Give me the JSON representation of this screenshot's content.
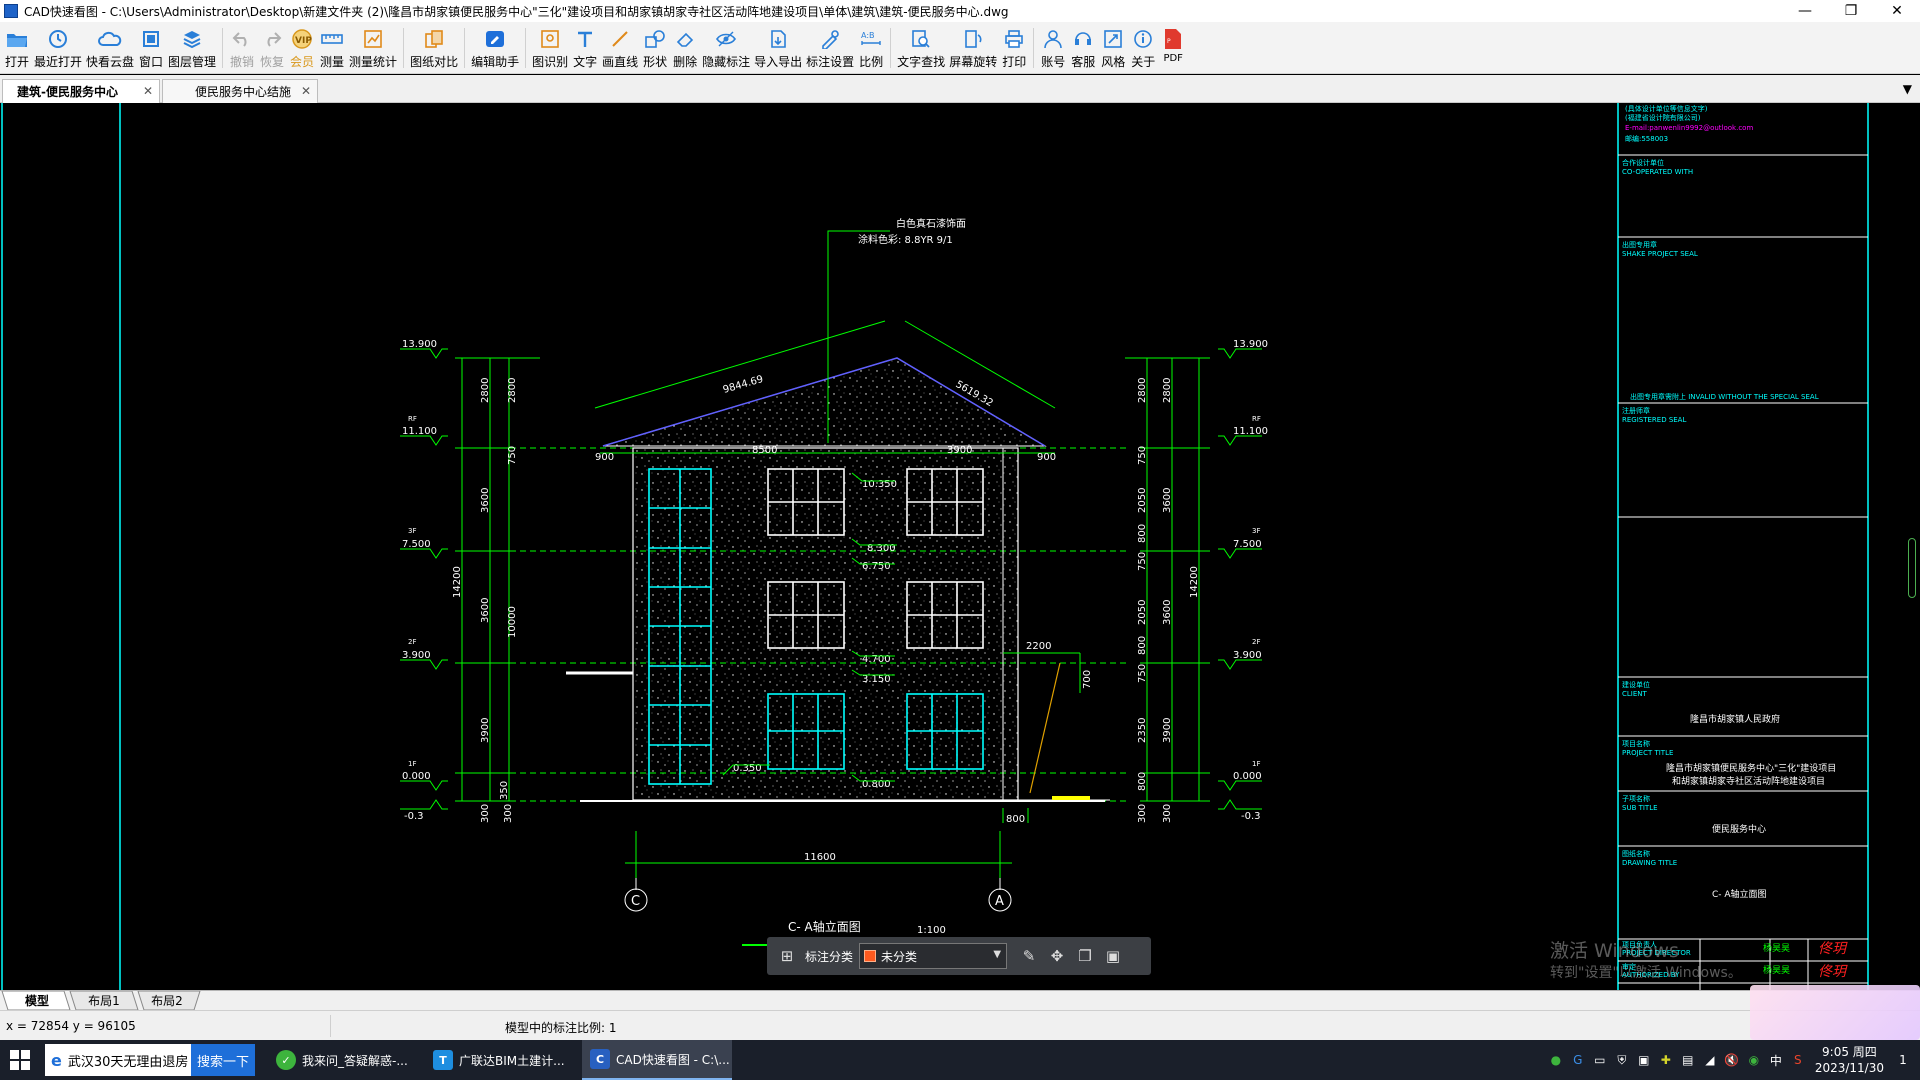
{
  "window": {
    "title": "CAD快速看图 - C:\\Users\\Administrator\\Desktop\\新建文件夹 (2)\\隆昌市胡家镇便民服务中心\"三化\"建设项目和胡家镇胡家寺社区活动阵地建设项目\\单体\\建筑\\建筑-便民服务中心.dwg",
    "controls": {
      "minimize": "—",
      "maximize": "❐",
      "close": "✕"
    }
  },
  "toolbar": [
    {
      "label": "打开",
      "icon": "open-folder-icon"
    },
    {
      "label": "最近打开",
      "icon": "recent-icon"
    },
    {
      "label": "快看云盘",
      "icon": "cloud-icon"
    },
    {
      "label": "窗口",
      "icon": "window-icon"
    },
    {
      "label": "图层管理",
      "icon": "layers-icon"
    },
    {
      "label": "撤销",
      "icon": "undo-icon",
      "disabled": true
    },
    {
      "label": "恢复",
      "icon": "redo-icon",
      "disabled": true
    },
    {
      "label": "会员",
      "icon": "vip-icon",
      "vip": true
    },
    {
      "label": "测量",
      "icon": "measure-icon"
    },
    {
      "label": "测量统计",
      "icon": "measure-stats-icon"
    },
    {
      "label": "图纸对比",
      "icon": "compare-icon"
    },
    {
      "label": "编辑助手",
      "icon": "edit-assistant-icon"
    },
    {
      "label": "图识别",
      "icon": "recognize-icon"
    },
    {
      "label": "文字",
      "icon": "text-icon"
    },
    {
      "label": "画直线",
      "icon": "line-icon"
    },
    {
      "label": "形状",
      "icon": "shape-icon"
    },
    {
      "label": "删除",
      "icon": "eraser-icon"
    },
    {
      "label": "隐藏标注",
      "icon": "hide-annotation-icon"
    },
    {
      "label": "导入导出",
      "icon": "import-export-icon"
    },
    {
      "label": "标注设置",
      "icon": "annotation-settings-icon"
    },
    {
      "label": "比例",
      "icon": "scale-icon"
    },
    {
      "label": "文字查找",
      "icon": "text-search-icon"
    },
    {
      "label": "屏幕旋转",
      "icon": "rotate-screen-icon"
    },
    {
      "label": "打印",
      "icon": "print-icon"
    },
    {
      "label": "账号",
      "icon": "account-icon"
    },
    {
      "label": "客服",
      "icon": "support-icon"
    },
    {
      "label": "风格",
      "icon": "style-icon"
    },
    {
      "label": "关于",
      "icon": "about-icon"
    },
    {
      "label": "PDF",
      "icon": "pdf-icon"
    }
  ],
  "doc_tabs": [
    {
      "label": "建筑-便民服务中心",
      "active": true
    },
    {
      "label": "便民服务中心结施",
      "active": false
    }
  ],
  "drawing": {
    "title_label": "C- A轴立面图",
    "scale_label": "1:100",
    "note_line1": "白色真石漆饰面",
    "note_line2": "涂料色彩: 8.8YR 9/1",
    "left_levels": [
      {
        "name": "",
        "value": "13.900"
      },
      {
        "name": "RF",
        "value": "11.100"
      },
      {
        "name": "3F",
        "value": "7.500"
      },
      {
        "name": "2F",
        "value": "3.900"
      },
      {
        "name": "1F",
        "value": "0.000"
      },
      {
        "name": "",
        "value": "-0.3"
      }
    ],
    "right_levels": [
      {
        "name": "",
        "value": "13.900"
      },
      {
        "name": "RF",
        "value": "11.100"
      },
      {
        "name": "3F",
        "value": "7.500"
      },
      {
        "name": "2F",
        "value": "3.900"
      },
      {
        "name": "1F",
        "value": "0.000"
      },
      {
        "name": "",
        "value": "-0.3"
      }
    ],
    "left_dims_outer": [
      "2800",
      "3600",
      "3600",
      "3900",
      "350"
    ],
    "left_dims_mid": [
      "14200",
      "10000"
    ],
    "left_dims_inner": [
      "2800",
      "750",
      "3600",
      "3900"
    ],
    "left_bottom_dims": [
      "300",
      "300"
    ],
    "right_dims_inner": [
      "2800",
      "750",
      "2050",
      "800",
      "750",
      "2050",
      "800",
      "750",
      "2350",
      "800"
    ],
    "right_dims_mid": [
      "2800",
      "3600",
      "3600",
      "3900"
    ],
    "right_dims_outer": [
      "14200"
    ],
    "right_bottom_dims": [
      "300",
      "300"
    ],
    "roof_dims": [
      "9844.69",
      "5619.32"
    ],
    "top_dims": [
      "900",
      "8500",
      "3900",
      "900"
    ],
    "inner_levels": [
      "10.350",
      "8.300",
      "6.750",
      "4.700",
      "3.150",
      "0.350",
      "0.800"
    ],
    "side_dims": [
      "2200",
      "700",
      "800"
    ],
    "bottom_dim": "11600",
    "axis_left": "C",
    "axis_right": "A"
  },
  "title_block": {
    "lines_top": [
      "(具体设计单位等信息文字)",
      "(福建省设计院有限公司)",
      "E-mail:panwenlin9992@outlook.com",
      "邮编:558003"
    ],
    "co_label_cn": "合作设计单位",
    "co_label_en": "CO-OPERATED WITH",
    "seal_label_cn": "出图专用章",
    "seal_label_en": "SHAKE PROJECT SEAL",
    "seal_note": "出图专用章需附上 INVALID WITHOUT THE SPECIAL SEAL",
    "reg_label_cn": "注册师章",
    "reg_label_en": "REGISTERED SEAL",
    "client_cn": "建设单位",
    "client_en": "CLIENT",
    "client_value": "隆昌市胡家镇人民政府",
    "project_cn": "项目名称",
    "project_en": "PROJECT TITLE",
    "project_value1": "隆昌市胡家镇便民服务中心\"三化\"建设项目",
    "project_value2": "和胡家镇胡家寺社区活动阵地建设项目",
    "sub_cn": "子项名称",
    "sub_en": "SUB TITLE",
    "sub_value": "便民服务中心",
    "drawing_cn": "图纸名称",
    "drawing_en": "DRAWING TITLE",
    "drawing_value": "C- A轴立面图",
    "director_cn": "项目负责人",
    "director_en": "PROJECT DIRECTOR",
    "auth_cn": "审定",
    "auth_en": "AUTHORIZED BY",
    "sign_name": "杨昊昊"
  },
  "float_toolbar": {
    "label": "标注分类",
    "select_value": "未分类",
    "swatch_color": "#ff5a1f"
  },
  "layout_tabs": [
    "模型",
    "布局1",
    "布局2"
  ],
  "status": {
    "coords": "x = 72854  y = 96105",
    "scale_text": "模型中的标注比例: 1"
  },
  "watermark": {
    "line1": "激活 Windows",
    "line2": "转到\"设置\"以激活 Windows。"
  },
  "taskbar": {
    "search_text": "武汉30天无理由退房",
    "search_button": "搜索一下",
    "apps": [
      {
        "label": "我来问_答疑解惑-...",
        "icon": "browser-icon",
        "color": "#3db43d"
      },
      {
        "label": "广联达BIM土建计...",
        "icon": "glodon-icon",
        "color": "#1e8ee0"
      },
      {
        "label": "CAD快速看图 - C:\\...",
        "icon": "cad-icon",
        "color": "#2860c0"
      }
    ],
    "time": "9:05 周四",
    "date": "2023/11/30",
    "ime": "中",
    "notification_count": "1"
  },
  "colors": {
    "cyan": "#00ffff",
    "green": "#00ff00",
    "yellow": "#ffff00",
    "white": "#ffffff",
    "magenta": "#ff00ff",
    "blue": "#4040ff"
  }
}
